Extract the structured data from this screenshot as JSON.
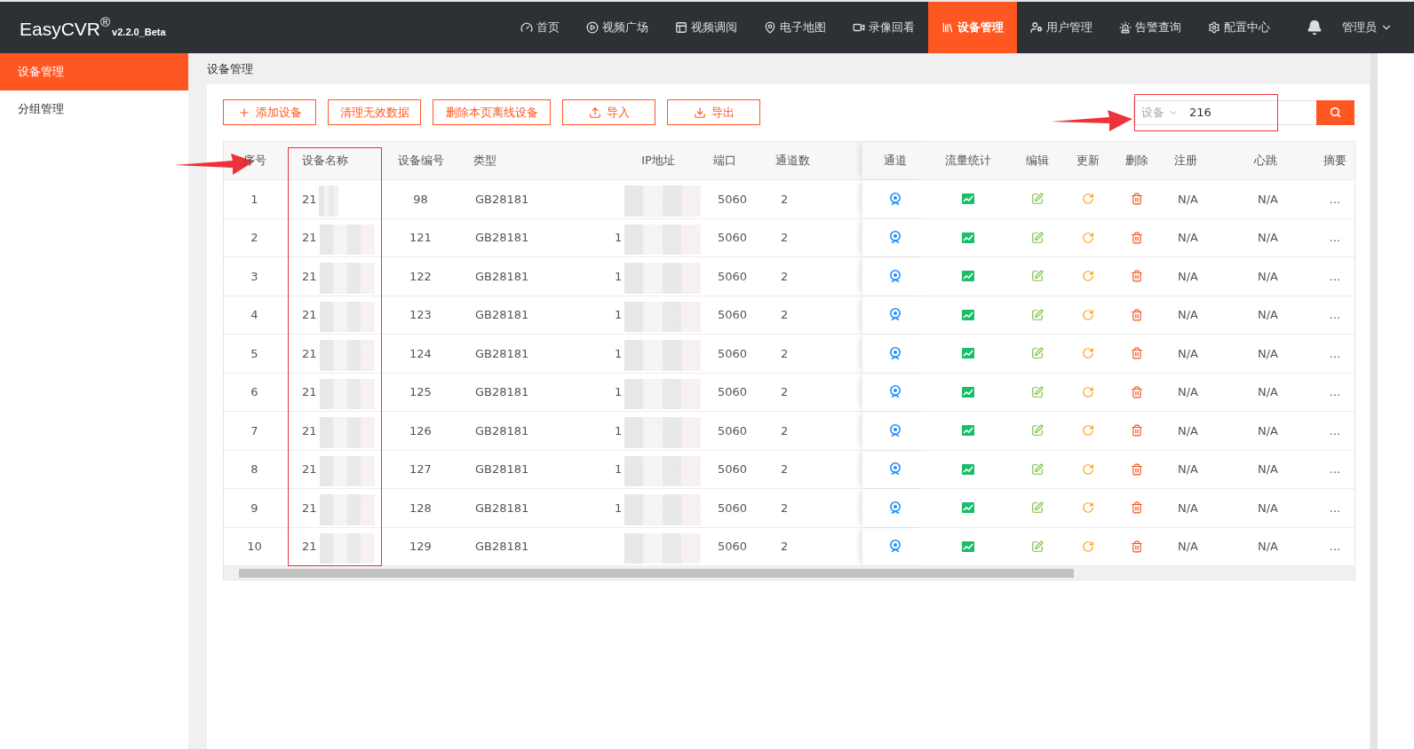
{
  "app": {
    "logo": "EasyCVR",
    "logo_mark": "®",
    "version": "v2.2.0_Beta"
  },
  "nav": [
    {
      "label": "首页",
      "selected": false
    },
    {
      "label": "视频广场",
      "selected": false
    },
    {
      "label": "视频调阅",
      "selected": false
    },
    {
      "label": "电子地图",
      "selected": false
    },
    {
      "label": "录像回看",
      "selected": false
    },
    {
      "label": "设备管理",
      "selected": true
    },
    {
      "label": "用户管理",
      "selected": false
    },
    {
      "label": "告警查询",
      "selected": false
    },
    {
      "label": "配置中心",
      "selected": false
    }
  ],
  "user": {
    "label": "管理员"
  },
  "sidebar": {
    "items": [
      {
        "label": "设备管理",
        "selected": true
      },
      {
        "label": "分组管理",
        "selected": false
      }
    ]
  },
  "breadcrumb": "设备管理",
  "toolbar": {
    "buttons": [
      {
        "label": "添加设备"
      },
      {
        "label": "清理无效数据"
      },
      {
        "label": "删除本页离线设备"
      },
      {
        "label": "导入"
      },
      {
        "label": "导出"
      }
    ]
  },
  "search": {
    "scope": "设备",
    "value": "216"
  },
  "table": {
    "columns": [
      "序号",
      "设备名称",
      "设备编号",
      "类型",
      "IP地址",
      "端口",
      "通道数",
      "通道",
      "流量统计",
      "编辑",
      "更新",
      "删除",
      "注册",
      "心跳",
      "摘要"
    ],
    "rows": [
      {
        "index": "1",
        "name": "21",
        "number": "98",
        "type": "GB28181",
        "port": "5060",
        "channels": "2",
        "register": "N/A",
        "heartbeat": "N/A",
        "summary": "..."
      },
      {
        "index": "2",
        "name": "21",
        "number": "121",
        "type": "GB28181",
        "ip": "1",
        "port": "5060",
        "channels": "2",
        "register": "N/A",
        "heartbeat": "N/A",
        "summary": "..."
      },
      {
        "index": "3",
        "name": "21",
        "number": "122",
        "type": "GB28181",
        "ip": "1",
        "port": "5060",
        "channels": "2",
        "register": "N/A",
        "heartbeat": "N/A",
        "summary": "..."
      },
      {
        "index": "4",
        "name": "21",
        "number": "123",
        "type": "GB28181",
        "ip": "1",
        "port": "5060",
        "channels": "2",
        "register": "N/A",
        "heartbeat": "N/A",
        "summary": "..."
      },
      {
        "index": "5",
        "name": "21",
        "number": "124",
        "type": "GB28181",
        "ip": "1",
        "port": "5060",
        "channels": "2",
        "register": "N/A",
        "heartbeat": "N/A",
        "summary": "..."
      },
      {
        "index": "6",
        "name": "21",
        "number": "125",
        "type": "GB28181",
        "ip": "1",
        "port": "5060",
        "channels": "2",
        "register": "N/A",
        "heartbeat": "N/A",
        "summary": "..."
      },
      {
        "index": "7",
        "name": "21",
        "number": "126",
        "type": "GB28181",
        "ip": "1",
        "port": "5060",
        "channels": "2",
        "register": "N/A",
        "heartbeat": "N/A",
        "summary": "..."
      },
      {
        "index": "8",
        "name": "21",
        "number": "127",
        "type": "GB28181",
        "ip": "1",
        "port": "5060",
        "channels": "2",
        "register": "N/A",
        "heartbeat": "N/A",
        "summary": "..."
      },
      {
        "index": "9",
        "name": "21",
        "number": "128",
        "type": "GB28181",
        "ip": "1",
        "port": "5060",
        "channels": "2",
        "register": "N/A",
        "heartbeat": "N/A",
        "summary": "..."
      },
      {
        "index": "10",
        "name": "21",
        "number": "129",
        "type": "GB28181",
        "port": "5060",
        "channels": "2",
        "register": "N/A",
        "heartbeat": "N/A",
        "summary": "..."
      }
    ]
  }
}
